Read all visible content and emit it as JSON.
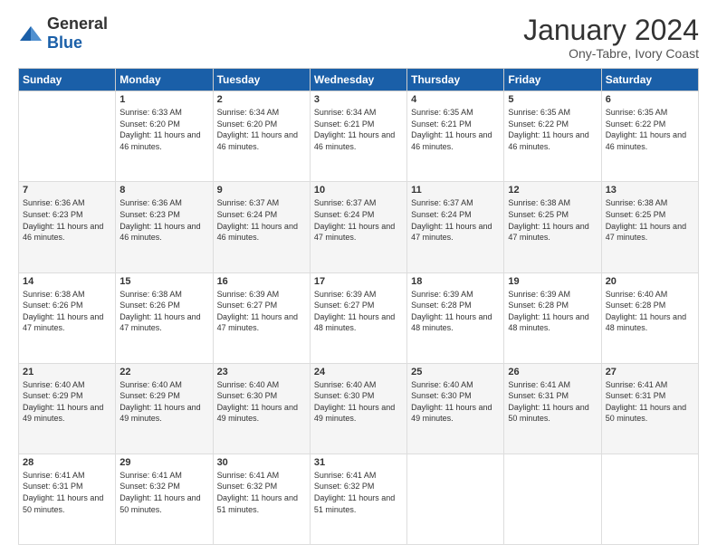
{
  "logo": {
    "general": "General",
    "blue": "Blue"
  },
  "header": {
    "month": "January 2024",
    "location": "Ony-Tabre, Ivory Coast"
  },
  "weekdays": [
    "Sunday",
    "Monday",
    "Tuesday",
    "Wednesday",
    "Thursday",
    "Friday",
    "Saturday"
  ],
  "weeks": [
    [
      {
        "day": "",
        "info": ""
      },
      {
        "day": "1",
        "info": "Sunrise: 6:33 AM\nSunset: 6:20 PM\nDaylight: 11 hours and 46 minutes."
      },
      {
        "day": "2",
        "info": "Sunrise: 6:34 AM\nSunset: 6:20 PM\nDaylight: 11 hours and 46 minutes."
      },
      {
        "day": "3",
        "info": "Sunrise: 6:34 AM\nSunset: 6:21 PM\nDaylight: 11 hours and 46 minutes."
      },
      {
        "day": "4",
        "info": "Sunrise: 6:35 AM\nSunset: 6:21 PM\nDaylight: 11 hours and 46 minutes."
      },
      {
        "day": "5",
        "info": "Sunrise: 6:35 AM\nSunset: 6:22 PM\nDaylight: 11 hours and 46 minutes."
      },
      {
        "day": "6",
        "info": "Sunrise: 6:35 AM\nSunset: 6:22 PM\nDaylight: 11 hours and 46 minutes."
      }
    ],
    [
      {
        "day": "7",
        "info": "Sunrise: 6:36 AM\nSunset: 6:23 PM\nDaylight: 11 hours and 46 minutes."
      },
      {
        "day": "8",
        "info": "Sunrise: 6:36 AM\nSunset: 6:23 PM\nDaylight: 11 hours and 46 minutes."
      },
      {
        "day": "9",
        "info": "Sunrise: 6:37 AM\nSunset: 6:24 PM\nDaylight: 11 hours and 46 minutes."
      },
      {
        "day": "10",
        "info": "Sunrise: 6:37 AM\nSunset: 6:24 PM\nDaylight: 11 hours and 47 minutes."
      },
      {
        "day": "11",
        "info": "Sunrise: 6:37 AM\nSunset: 6:24 PM\nDaylight: 11 hours and 47 minutes."
      },
      {
        "day": "12",
        "info": "Sunrise: 6:38 AM\nSunset: 6:25 PM\nDaylight: 11 hours and 47 minutes."
      },
      {
        "day": "13",
        "info": "Sunrise: 6:38 AM\nSunset: 6:25 PM\nDaylight: 11 hours and 47 minutes."
      }
    ],
    [
      {
        "day": "14",
        "info": "Sunrise: 6:38 AM\nSunset: 6:26 PM\nDaylight: 11 hours and 47 minutes."
      },
      {
        "day": "15",
        "info": "Sunrise: 6:38 AM\nSunset: 6:26 PM\nDaylight: 11 hours and 47 minutes."
      },
      {
        "day": "16",
        "info": "Sunrise: 6:39 AM\nSunset: 6:27 PM\nDaylight: 11 hours and 47 minutes."
      },
      {
        "day": "17",
        "info": "Sunrise: 6:39 AM\nSunset: 6:27 PM\nDaylight: 11 hours and 48 minutes."
      },
      {
        "day": "18",
        "info": "Sunrise: 6:39 AM\nSunset: 6:28 PM\nDaylight: 11 hours and 48 minutes."
      },
      {
        "day": "19",
        "info": "Sunrise: 6:39 AM\nSunset: 6:28 PM\nDaylight: 11 hours and 48 minutes."
      },
      {
        "day": "20",
        "info": "Sunrise: 6:40 AM\nSunset: 6:28 PM\nDaylight: 11 hours and 48 minutes."
      }
    ],
    [
      {
        "day": "21",
        "info": "Sunrise: 6:40 AM\nSunset: 6:29 PM\nDaylight: 11 hours and 49 minutes."
      },
      {
        "day": "22",
        "info": "Sunrise: 6:40 AM\nSunset: 6:29 PM\nDaylight: 11 hours and 49 minutes."
      },
      {
        "day": "23",
        "info": "Sunrise: 6:40 AM\nSunset: 6:30 PM\nDaylight: 11 hours and 49 minutes."
      },
      {
        "day": "24",
        "info": "Sunrise: 6:40 AM\nSunset: 6:30 PM\nDaylight: 11 hours and 49 minutes."
      },
      {
        "day": "25",
        "info": "Sunrise: 6:40 AM\nSunset: 6:30 PM\nDaylight: 11 hours and 49 minutes."
      },
      {
        "day": "26",
        "info": "Sunrise: 6:41 AM\nSunset: 6:31 PM\nDaylight: 11 hours and 50 minutes."
      },
      {
        "day": "27",
        "info": "Sunrise: 6:41 AM\nSunset: 6:31 PM\nDaylight: 11 hours and 50 minutes."
      }
    ],
    [
      {
        "day": "28",
        "info": "Sunrise: 6:41 AM\nSunset: 6:31 PM\nDaylight: 11 hours and 50 minutes."
      },
      {
        "day": "29",
        "info": "Sunrise: 6:41 AM\nSunset: 6:32 PM\nDaylight: 11 hours and 50 minutes."
      },
      {
        "day": "30",
        "info": "Sunrise: 6:41 AM\nSunset: 6:32 PM\nDaylight: 11 hours and 51 minutes."
      },
      {
        "day": "31",
        "info": "Sunrise: 6:41 AM\nSunset: 6:32 PM\nDaylight: 11 hours and 51 minutes."
      },
      {
        "day": "",
        "info": ""
      },
      {
        "day": "",
        "info": ""
      },
      {
        "day": "",
        "info": ""
      }
    ]
  ]
}
